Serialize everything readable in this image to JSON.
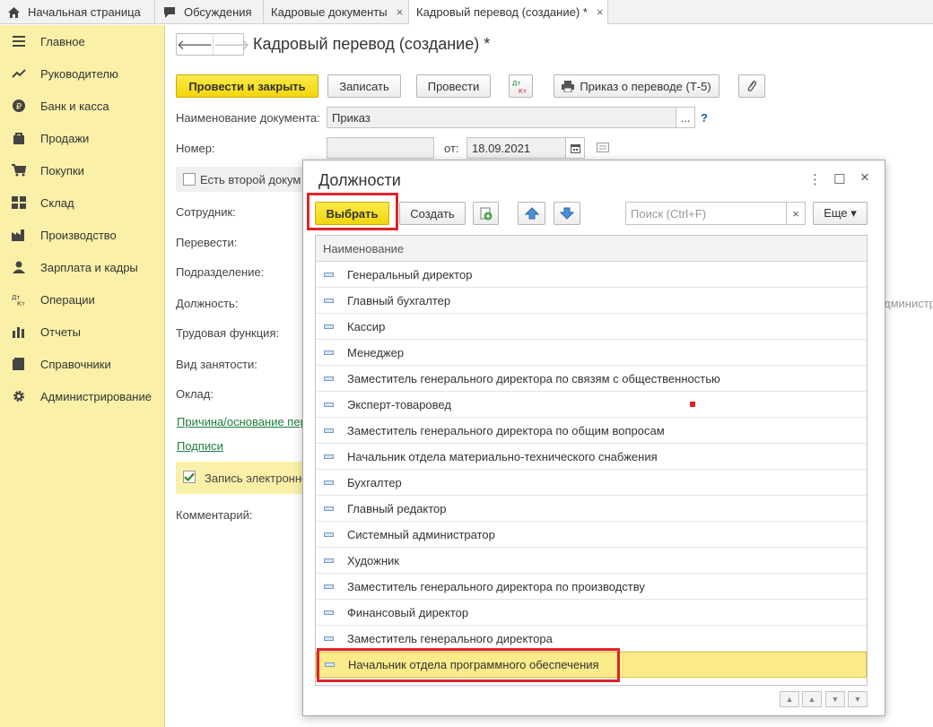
{
  "tabs": [
    {
      "label": "Начальная страница",
      "icon": "home-icon"
    },
    {
      "label": "Обсуждения",
      "icon": "chat-icon"
    },
    {
      "label": "Кадровые документы",
      "close": "×"
    },
    {
      "label": "Кадровый перевод (создание) *",
      "close": "×"
    }
  ],
  "sidebar": {
    "items": [
      {
        "label": "Главное",
        "icon": "menu-icon"
      },
      {
        "label": "Руководителю",
        "icon": "chart-line-icon"
      },
      {
        "label": "Банк и касса",
        "icon": "ruble-icon"
      },
      {
        "label": "Продажи",
        "icon": "bag-icon"
      },
      {
        "label": "Покупки",
        "icon": "cart-icon"
      },
      {
        "label": "Склад",
        "icon": "warehouse-icon"
      },
      {
        "label": "Производство",
        "icon": "factory-icon"
      },
      {
        "label": "Зарплата и кадры",
        "icon": "person-icon"
      },
      {
        "label": "Операции",
        "icon": "dt-kt-icon"
      },
      {
        "label": "Отчеты",
        "icon": "bar-chart-icon"
      },
      {
        "label": "Справочники",
        "icon": "book-icon"
      },
      {
        "label": "Администрирование",
        "icon": "gear-icon"
      }
    ]
  },
  "form": {
    "title": "Кадровый перевод (создание) *",
    "buttons": {
      "post_close": "Провести и закрыть",
      "save": "Записать",
      "post": "Провести",
      "dtkt": "Дт Кт",
      "print": "Приказ о переводе (Т-5)"
    },
    "labels": {
      "doc_name": "Наименование документа:",
      "number": "Номер:",
      "date_from": "от:",
      "second_doc": "Есть второй докум",
      "employee": "Сотрудник:",
      "transfer": "Перевести:",
      "department": "Подразделение:",
      "position": "Должность:",
      "labor_function": "Трудовая функция:",
      "employment_type": "Вид занятости:",
      "salary": "Оклад:",
      "reason_link": "Причина/основание пер",
      "signatures_link": "Подписи",
      "electronic": "Запись электронно",
      "comment": "Комментарий:",
      "right_edge_text": "дминистрат"
    },
    "values": {
      "doc_name": "Приказ",
      "doc_name_more": "...",
      "help": "?",
      "number": "",
      "date": "18.09.2021"
    }
  },
  "dialog": {
    "title": "Должности",
    "controls": {
      "more": "⋮",
      "maximize": "☐",
      "close": "×"
    },
    "toolbar": {
      "select": "Выбрать",
      "create": "Создать",
      "search_placeholder": "Поиск (Ctrl+F)",
      "search_clear": "×",
      "more": "Еще ▾"
    },
    "column_header": "Наименование",
    "rows": [
      "Генеральный директор",
      "Главный бухгалтер",
      "Кассир",
      "Менеджер",
      "Заместитель генерального директора по связям с общественностью",
      "Эксперт-товаровед",
      "Заместитель генерального директора по общим вопросам",
      "Начальник отдела материально-технического снабжения",
      "Бухгалтер",
      "Главный редактор",
      "Системный администратор",
      "Художник",
      "Заместитель генерального директора по производству",
      "Финансовый директор",
      "Заместитель генерального директора",
      "Начальник отдела программного обеспечения"
    ],
    "selected_index": 15,
    "colors": {
      "accent_red": "#e0232a",
      "selected_row": "#fbeb8a",
      "button_yellow": "#f5dc1f"
    }
  }
}
